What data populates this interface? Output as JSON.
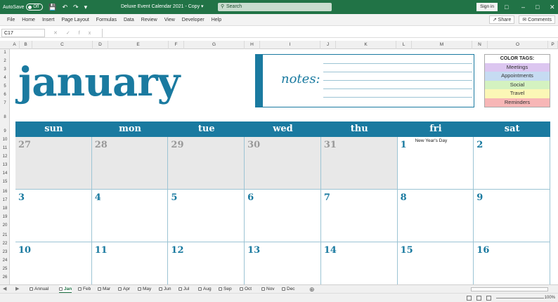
{
  "titlebar": {
    "autosave_label": "AutoSave",
    "autosave_state": "Off",
    "doc_title": "Deluxe Event Calendar 2021 - Copy",
    "search_placeholder": "Search",
    "signin_label": "Sign in"
  },
  "menu": {
    "items": [
      "File",
      "Home",
      "Insert",
      "Page Layout",
      "Formulas",
      "Data",
      "Review",
      "View",
      "Developer",
      "Help"
    ],
    "share": "Share",
    "comments": "Comments"
  },
  "formula": {
    "cell_ref": "C17",
    "fx": "fx"
  },
  "grid": {
    "columns": [
      "A",
      "B",
      "C",
      "D",
      "E",
      "F",
      "G",
      "H",
      "I",
      "J",
      "K",
      "L",
      "M",
      "N",
      "O",
      "P"
    ],
    "rows": [
      "1",
      "2",
      "3",
      "4",
      "5",
      "6",
      "7",
      "8",
      "9",
      "10",
      "11",
      "12",
      "13",
      "14",
      "15",
      "16",
      "17",
      "18",
      "19",
      "20",
      "21",
      "22",
      "23",
      "24",
      "25",
      "26"
    ]
  },
  "calendar": {
    "month": "january",
    "notes_label": "notes:",
    "color_tags_title": "COLOR TAGS:",
    "color_tags": [
      {
        "label": "Meetings",
        "color": "#dcc6f0"
      },
      {
        "label": "Appointments",
        "color": "#c6dbf2"
      },
      {
        "label": "Social",
        "color": "#d4f2c0"
      },
      {
        "label": "Travel",
        "color": "#fbf7b6"
      },
      {
        "label": "Reminders",
        "color": "#f7b6b6"
      }
    ],
    "days": [
      "sun",
      "mon",
      "tue",
      "wed",
      "thu",
      "fri",
      "sat"
    ],
    "weeks": [
      [
        {
          "num": "27",
          "prev": true
        },
        {
          "num": "28",
          "prev": true
        },
        {
          "num": "29",
          "prev": true
        },
        {
          "num": "30",
          "prev": true
        },
        {
          "num": "31",
          "prev": true
        },
        {
          "num": "1",
          "event": "New Year's Day"
        },
        {
          "num": "2"
        }
      ],
      [
        {
          "num": "3"
        },
        {
          "num": "4"
        },
        {
          "num": "5"
        },
        {
          "num": "6"
        },
        {
          "num": "7"
        },
        {
          "num": "8"
        },
        {
          "num": "9"
        }
      ],
      [
        {
          "num": "10"
        },
        {
          "num": "11"
        },
        {
          "num": "12"
        },
        {
          "num": "13"
        },
        {
          "num": "14"
        },
        {
          "num": "15"
        },
        {
          "num": "16"
        }
      ]
    ],
    "accent_color": "#1a7aa0"
  },
  "sheet_tabs": {
    "tabs": [
      "Annual",
      "Jan",
      "Feb",
      "Mar",
      "Apr",
      "May",
      "Jun",
      "Jul",
      "Aug",
      "Sep",
      "Oct",
      "Nov",
      "Dec"
    ],
    "active": "Jan"
  },
  "status": {
    "zoom": "100%"
  }
}
